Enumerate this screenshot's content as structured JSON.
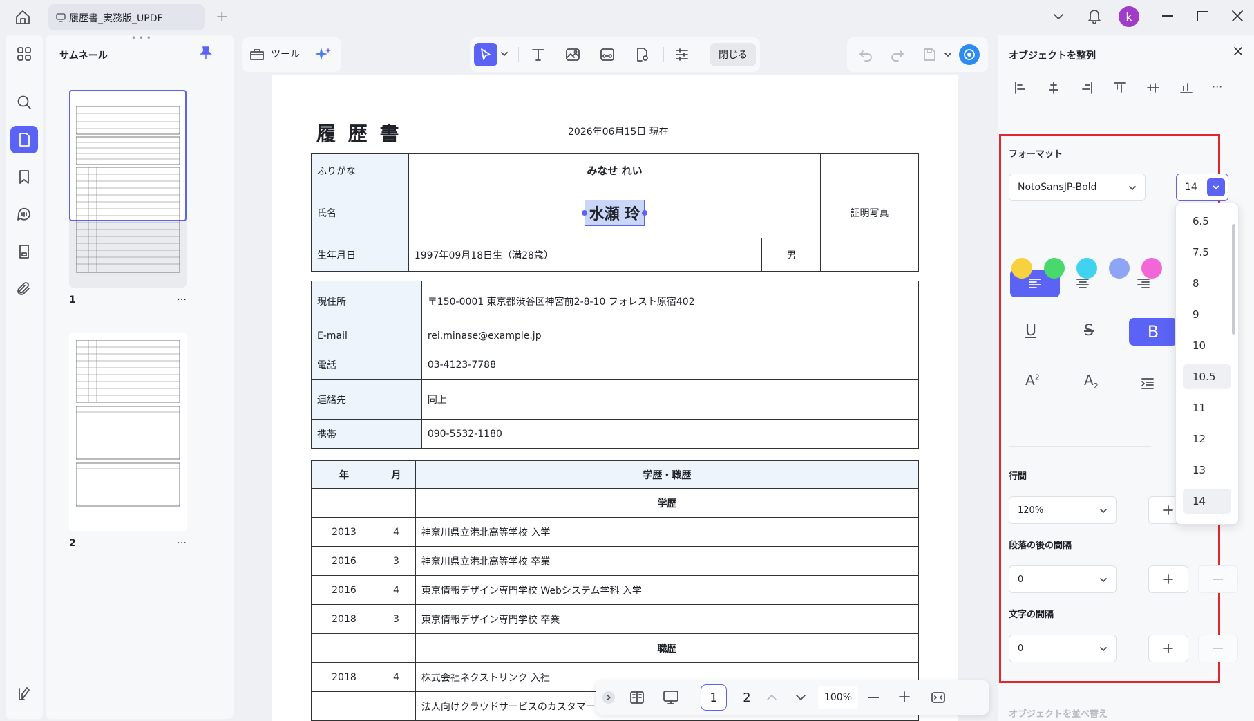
{
  "window": {
    "tab_title": "履歴書_実務版_UPDF",
    "avatar_letter": "k"
  },
  "sidebar": {
    "title": "サムネール",
    "pages": [
      {
        "num": "1",
        "menu": "…"
      },
      {
        "num": "2",
        "menu": "…"
      }
    ]
  },
  "toolbar": {
    "tools_label": "ツール",
    "close_label": "閉じる"
  },
  "doc": {
    "title": "履 歴 書",
    "date": "2026年06月15日 現在",
    "furigana_label": "ふりがな",
    "furigana": "みなせ れい",
    "name_label": "氏名",
    "name": "水瀬 玲",
    "photo": "証明写真",
    "dob_label": "生年月日",
    "dob": "1997年09月18日生（満28歳）",
    "gender": "男",
    "contact": [
      {
        "label": "現住所",
        "value": "〒150-0001 東京都渋谷区神宮前2-8-10 フォレスト原宿402"
      },
      {
        "label": "E-mail",
        "value": "rei.minase@example.jp"
      },
      {
        "label": "電話",
        "value": "03-4123-7788"
      },
      {
        "label": "連絡先",
        "value": "同上"
      },
      {
        "label": "携帯",
        "value": "090-5532-1180"
      }
    ],
    "history_headers": {
      "year": "年",
      "month": "月",
      "item": "学歴・職歴"
    },
    "history": [
      {
        "year": "",
        "month": "",
        "item": "学歴",
        "center": true
      },
      {
        "year": "2013",
        "month": "4",
        "item": "神奈川県立港北高等学校 入学"
      },
      {
        "year": "2016",
        "month": "3",
        "item": "神奈川県立港北高等学校 卒業"
      },
      {
        "year": "2016",
        "month": "4",
        "item": "東京情報デザイン専門学校 Webシステム学科 入学"
      },
      {
        "year": "2018",
        "month": "3",
        "item": "東京情報デザイン専門学校 卒業"
      },
      {
        "year": "",
        "month": "",
        "item": "職歴",
        "center": true
      },
      {
        "year": "2018",
        "month": "4",
        "item": "株式会社ネクストリンク 入社"
      },
      {
        "year": "",
        "month": "",
        "item": "法人向けクラウドサービスのカスタマー"
      }
    ]
  },
  "bottom_nav": {
    "page1": "1",
    "page2": "2",
    "zoom": "100%"
  },
  "panel": {
    "align_title": "オブジェクトを整列",
    "format_title": "フォーマット",
    "font": "NotoSansJP-Bold",
    "font_size": "14",
    "swatches": [
      "#f7d23e",
      "#47d96b",
      "#3fd3ef",
      "#8ea4f4",
      "#f266d8"
    ],
    "line_spacing_title": "行間",
    "line_spacing": "120%",
    "para_title": "段落の後の間隔",
    "para_value": "0",
    "char_title": "文字の間隔",
    "char_value": "0",
    "arrange_title": "オブジェクトを並べ替え",
    "size_options": [
      "6.5",
      "7.5",
      "8",
      "9",
      "10",
      "10.5",
      "11",
      "12",
      "13",
      "14"
    ],
    "highlight_color": "#e3262d",
    "accent": "#5b63f5"
  }
}
